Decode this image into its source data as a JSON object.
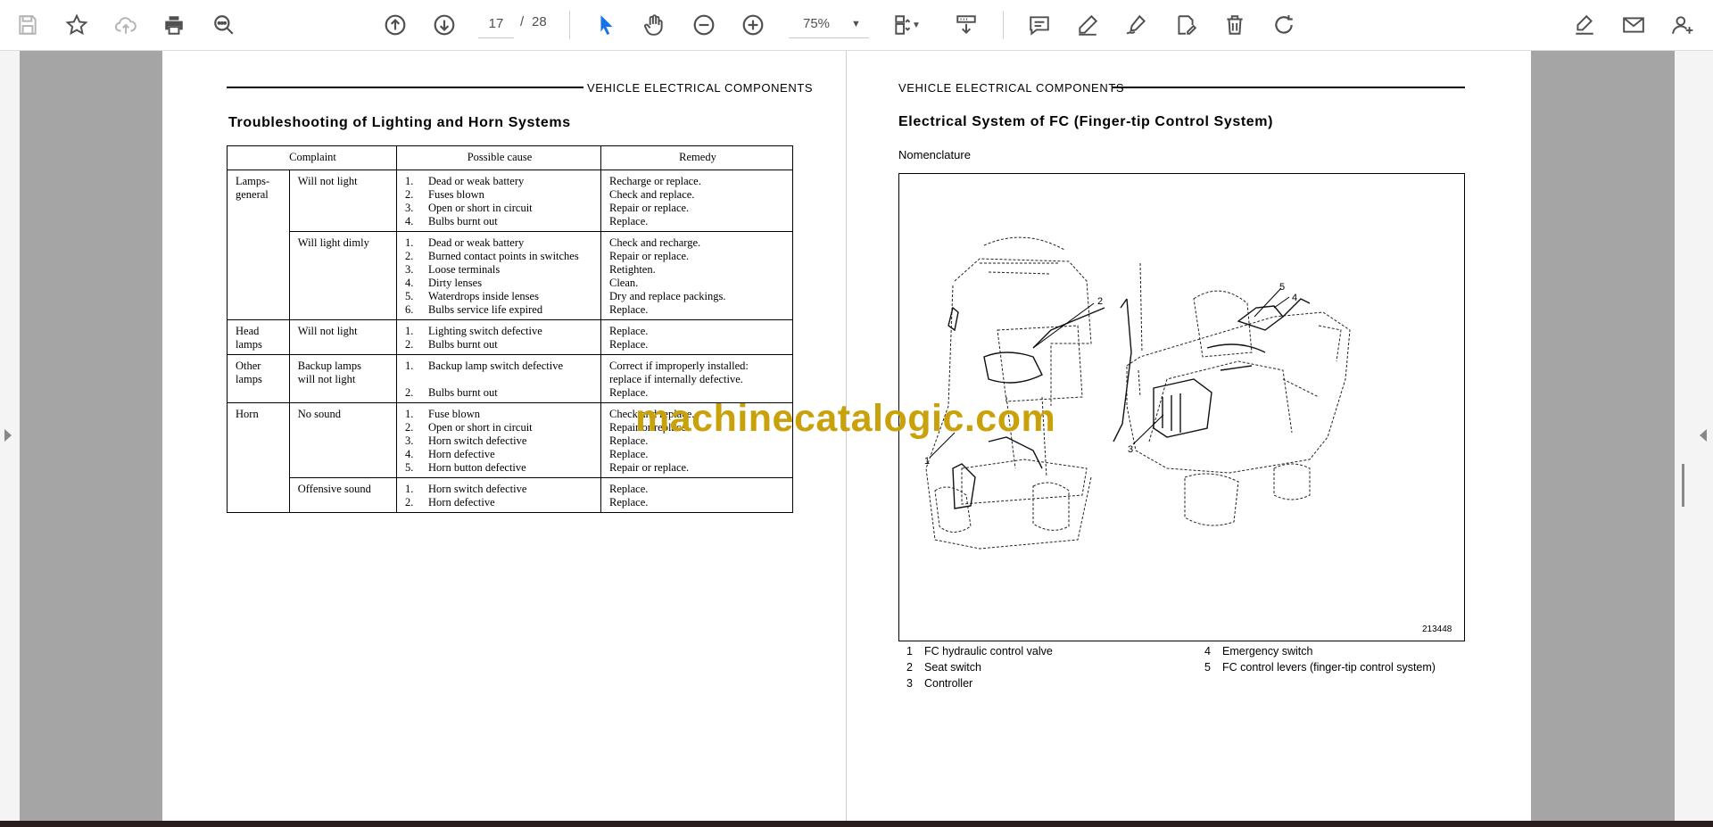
{
  "toolbar": {
    "page_current": "17",
    "page_separator": "/",
    "page_total": "28",
    "zoom": "75%",
    "icons": [
      "save-icon",
      "bookmark-star-icon",
      "cloud-upload-icon",
      "print-icon",
      "zoom-search-icon",
      "page-up-icon",
      "page-down-icon",
      "select-cursor-icon",
      "hand-tool-icon",
      "zoom-out-icon",
      "zoom-in-icon",
      "page-fit-icon",
      "scroll-mode-icon",
      "comment-icon",
      "highlight-pen-icon",
      "draw-sign-icon",
      "edit-text-icon",
      "delete-icon",
      "rotate-icon",
      "sign-edit-icon",
      "email-icon",
      "add-user-icon"
    ]
  },
  "left_page": {
    "header": "VEHICLE ELECTRICAL COMPONENTS",
    "title": "Troubleshooting of Lighting and Horn Systems",
    "columns": [
      "Complaint",
      "Possible cause",
      "Remedy"
    ],
    "groups": [
      {
        "group": [
          "Lamps-",
          "general"
        ],
        "rows": [
          {
            "complaint": [
              "Will not light"
            ],
            "causes": [
              [
                "1.",
                "Dead or weak battery"
              ],
              [
                "2.",
                "Fuses blown"
              ],
              [
                "3.",
                "Open or short in circuit"
              ],
              [
                "4.",
                "Bulbs burnt out"
              ]
            ],
            "remedies": [
              "Recharge or replace.",
              "Check and replace.",
              "Repair or replace.",
              "Replace."
            ]
          },
          {
            "complaint": [
              "Will light dimly"
            ],
            "causes": [
              [
                "1.",
                "Dead or weak battery"
              ],
              [
                "2.",
                "Burned contact points in switches"
              ],
              [
                "3.",
                "Loose terminals"
              ],
              [
                "4.",
                "Dirty lenses"
              ],
              [
                "5.",
                "Waterdrops inside lenses"
              ],
              [
                "6.",
                "Bulbs service life expired"
              ]
            ],
            "remedies": [
              "Check and recharge.",
              "Repair or replace.",
              "Retighten.",
              "Clean.",
              "Dry and replace packings.",
              "Replace."
            ]
          }
        ]
      },
      {
        "group": [
          "Head",
          "lamps"
        ],
        "rows": [
          {
            "complaint": [
              "Will not light"
            ],
            "causes": [
              [
                "1.",
                "Lighting switch defective"
              ],
              [
                "2.",
                "Bulbs burnt out"
              ]
            ],
            "remedies": [
              "Replace.",
              "Replace."
            ]
          }
        ]
      },
      {
        "group": [
          "Other",
          "lamps"
        ],
        "rows": [
          {
            "complaint": [
              "Backup lamps",
              "will not light"
            ],
            "causes": [
              [
                "1.",
                "Backup lamp switch defective"
              ],
              [
                "",
                ""
              ],
              [
                "2.",
                "Bulbs burnt out"
              ]
            ],
            "remedies": [
              "Correct if improperly installed:",
              "replace if internally defective.",
              "Replace."
            ]
          }
        ]
      },
      {
        "group": [
          "Horn"
        ],
        "rows": [
          {
            "complaint": [
              "No sound"
            ],
            "causes": [
              [
                "1.",
                "Fuse blown"
              ],
              [
                "2.",
                "Open or short in circuit"
              ],
              [
                "3.",
                "Horn switch defective"
              ],
              [
                "4.",
                "Horn defective"
              ],
              [
                "5.",
                "Horn button defective"
              ]
            ],
            "remedies": [
              "Check and replace.",
              "Repair or replace.",
              "Replace.",
              "Replace.",
              "Repair or replace."
            ]
          },
          {
            "complaint": [
              "Offensive sound"
            ],
            "causes": [
              [
                "1.",
                "Horn switch defective"
              ],
              [
                "2.",
                "Horn defective"
              ]
            ],
            "remedies": [
              "Replace.",
              "Replace."
            ]
          }
        ]
      }
    ]
  },
  "watermark": "machinecatalogic.com",
  "right_page": {
    "header": "VEHICLE ELECTRICAL COMPONENTS",
    "title": "Electrical System of FC (Finger-tip Control System)",
    "subtitle": "Nomenclature",
    "figure_id": "213448",
    "callouts": [
      "1",
      "2",
      "3",
      "4",
      "5"
    ],
    "legend_left": [
      {
        "num": "1",
        "text": "FC hydraulic control valve"
      },
      {
        "num": "2",
        "text": "Seat switch"
      },
      {
        "num": "3",
        "text": "Controller"
      }
    ],
    "legend_right": [
      {
        "num": "4",
        "text": "Emergency switch"
      },
      {
        "num": "5",
        "text": "FC control levers (finger-tip control system)"
      }
    ]
  },
  "colors": {
    "toolbar_bg": "#ffffff",
    "icon": "#505050",
    "icon_active": "#1473e6",
    "viewer_gray": "#a5a5a5",
    "watermark": "#c9a10a"
  }
}
